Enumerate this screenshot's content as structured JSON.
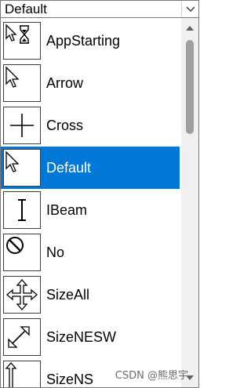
{
  "combo": {
    "selected_value": "Default"
  },
  "items": [
    {
      "label": "AppStarting",
      "icon": "app-starting-cursor-icon",
      "selected": false
    },
    {
      "label": "Arrow",
      "icon": "arrow-cursor-icon",
      "selected": false
    },
    {
      "label": "Cross",
      "icon": "cross-cursor-icon",
      "selected": false
    },
    {
      "label": "Default",
      "icon": "default-cursor-icon",
      "selected": true
    },
    {
      "label": "IBeam",
      "icon": "ibeam-cursor-icon",
      "selected": false
    },
    {
      "label": "No",
      "icon": "no-cursor-icon",
      "selected": false
    },
    {
      "label": "SizeAll",
      "icon": "size-all-cursor-icon",
      "selected": false
    },
    {
      "label": "SizeNESW",
      "icon": "size-nesw-cursor-icon",
      "selected": false
    },
    {
      "label": "SizeNS",
      "icon": "size-ns-cursor-icon",
      "selected": false
    }
  ],
  "colors": {
    "selection": "#0078d7"
  },
  "watermark": "CSDN @熊思宇"
}
